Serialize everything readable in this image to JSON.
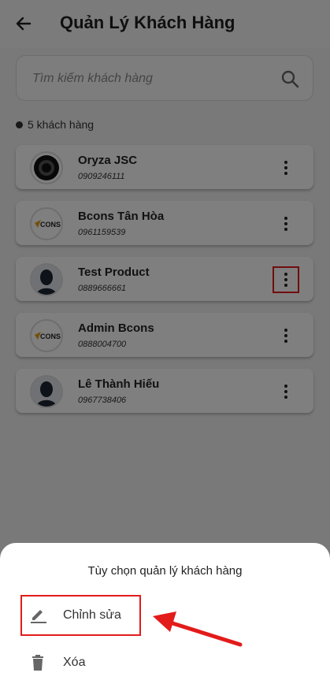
{
  "header": {
    "title": "Quản Lý Khách Hàng"
  },
  "search": {
    "placeholder": "Tìm kiếm khách hàng"
  },
  "summary": {
    "count_text": "5 khách hàng"
  },
  "customers": [
    {
      "name": "Oryza JSC",
      "phone": "0909246111",
      "avatar": "oryza-logo"
    },
    {
      "name": "Bcons Tân Hòa",
      "phone": "0961159539",
      "avatar": "bcons-logo"
    },
    {
      "name": "Test Product",
      "phone": "0889666661",
      "avatar": "person-silhouette"
    },
    {
      "name": "Admin Bcons",
      "phone": "0888004700",
      "avatar": "bcons-logo"
    },
    {
      "name": "Lê Thành Hiếu",
      "phone": "0967738406",
      "avatar": "person-silhouette"
    }
  ],
  "sheet": {
    "title": "Tùy chọn quản lý khách hàng",
    "options": [
      {
        "label": "Chỉnh sửa",
        "icon": "edit-icon"
      },
      {
        "label": "Xóa",
        "icon": "trash-icon"
      }
    ]
  },
  "colors": {
    "highlight": "#e31b1b",
    "overlay": "rgba(0,0,0,0.5)"
  }
}
